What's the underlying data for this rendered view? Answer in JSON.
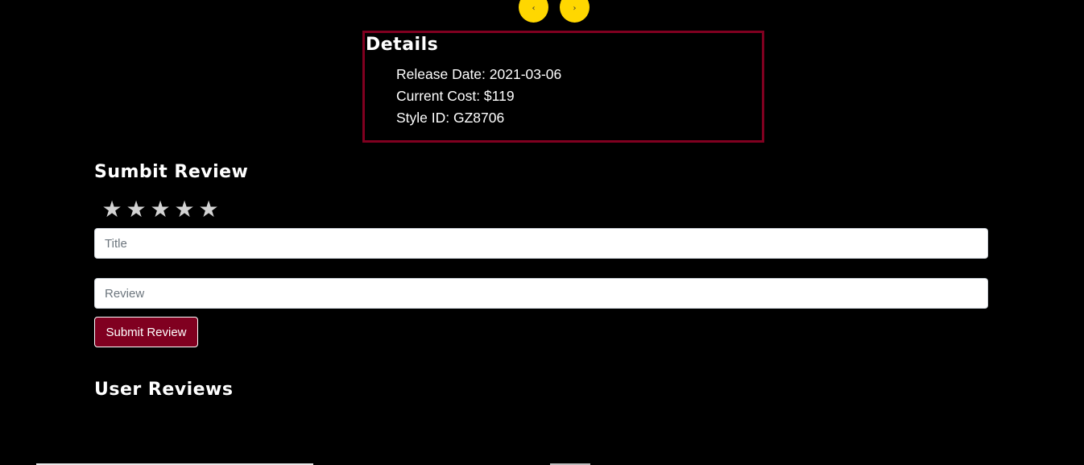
{
  "carousel": {
    "prev_icon": "chevron-left-icon",
    "prev_glyph": "‹",
    "next_icon": "chevron-right-icon",
    "next_glyph": "›",
    "button_color": "#ffd700"
  },
  "details": {
    "title": "Details",
    "items": [
      "Release Date: 2021-03-06",
      "Current Cost: $119",
      "Style ID: GZ8706"
    ],
    "border_color": "#800020"
  },
  "review_form": {
    "heading": "Sumbit Review",
    "rating": {
      "stars_total": 5,
      "stars_selected": 0,
      "glyph": "★",
      "icon": "star-icon"
    },
    "title_placeholder": "Title",
    "title_value": "",
    "review_placeholder": "Review",
    "review_value": "",
    "submit_label": "Submit Review",
    "submit_color": "#800020"
  },
  "user_reviews": {
    "heading": "User Reviews"
  }
}
